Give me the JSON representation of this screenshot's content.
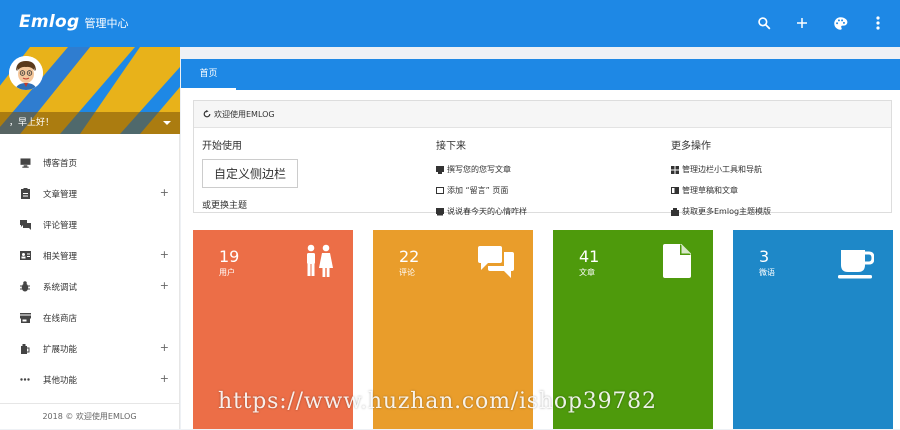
{
  "header": {
    "logo": "Emlog",
    "subtitle": "管理中心",
    "icons": [
      "search-icon",
      "plus-icon",
      "palette-icon",
      "more-vertical-icon"
    ]
  },
  "sidebar": {
    "greeting": "，早上好！",
    "items": [
      {
        "label": "博客首页",
        "icon": "monitor-icon",
        "expandable": false
      },
      {
        "label": "文章管理",
        "icon": "clipboard-icon",
        "expandable": true
      },
      {
        "label": "评论管理",
        "icon": "comments-icon",
        "expandable": false
      },
      {
        "label": "相关管理",
        "icon": "contact-card-icon",
        "expandable": true
      },
      {
        "label": "系统调试",
        "icon": "bug-icon",
        "expandable": true
      },
      {
        "label": "在线商店",
        "icon": "store-icon",
        "expandable": false
      },
      {
        "label": "扩展功能",
        "icon": "plug-icon",
        "expandable": true
      },
      {
        "label": "其他功能",
        "icon": "more-horizontal-icon",
        "expandable": true
      }
    ],
    "plus_symbol": "+",
    "footer": "2018 © 欢迎使用EMLOG"
  },
  "tabs": [
    {
      "label": "首页"
    }
  ],
  "welcome": {
    "title": "欢迎使用EMLOG",
    "start": {
      "heading": "开始使用",
      "button": "自定义侧边栏",
      "theme_link": "或更换主题"
    },
    "next": {
      "heading": "接下来",
      "links": [
        "撰写您的您写文章",
        "添加 “留言” 页面",
        "说说春今天的心情咋样"
      ]
    },
    "more": {
      "heading": "更多操作",
      "links": [
        "管理边栏小工具和导航",
        "管理草稿和文章",
        "获取更多Emlog主题模版"
      ]
    }
  },
  "stats": [
    {
      "value": "19",
      "label": "用户",
      "color": "#ec6e47",
      "icon": "users-icon"
    },
    {
      "value": "22",
      "label": "评论",
      "color": "#e99d2b",
      "icon": "chat-bubbles-icon"
    },
    {
      "value": "41",
      "label": "文章",
      "color": "#4e9a0c",
      "icon": "document-icon"
    },
    {
      "value": "3",
      "label": "微语",
      "color": "#1e88c8",
      "icon": "cup-icon"
    }
  ],
  "watermark": "https://www.huzhan.com/ishop39782",
  "colors": {
    "primary": "#1e88e5",
    "profile_yellow": "#e8b21a"
  }
}
